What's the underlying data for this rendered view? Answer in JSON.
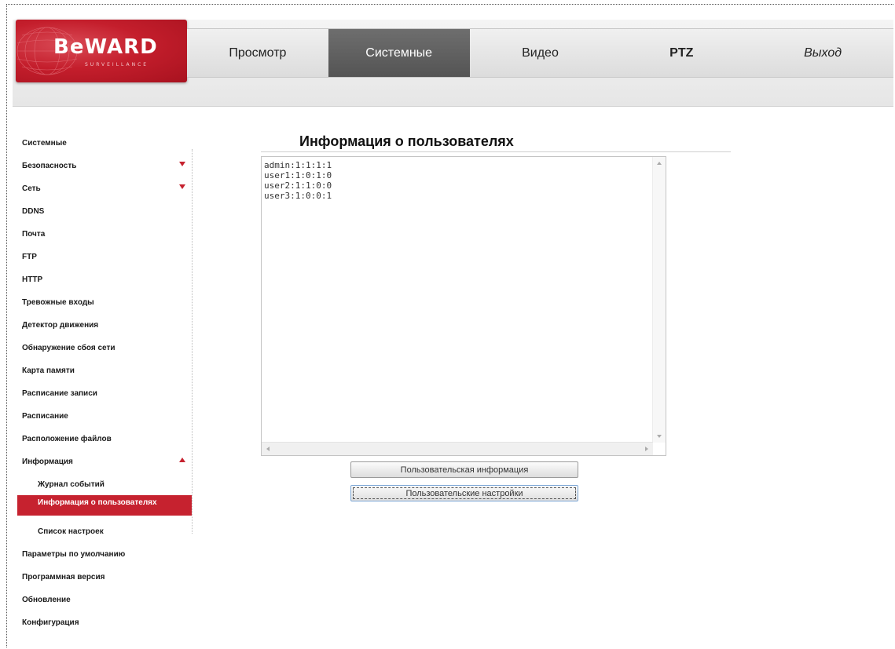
{
  "logo": {
    "text": "BeWARD",
    "subtext": "SURVEILLANCE",
    "icon": "beward-logo-icon",
    "color": "#c41e2c"
  },
  "nav": {
    "items": [
      {
        "label": "Просмотр"
      },
      {
        "label": "Системные",
        "active": true
      },
      {
        "label": "Видео"
      },
      {
        "label": "PTZ"
      },
      {
        "label": "Выход"
      }
    ]
  },
  "sidebar": {
    "items": [
      {
        "label": "Системные"
      },
      {
        "label": "Безопасность",
        "arrow": "chevron-down-icon"
      },
      {
        "label": "Сеть",
        "arrow": "chevron-down-icon"
      },
      {
        "label": "DDNS"
      },
      {
        "label": "Почта"
      },
      {
        "label": "FTP"
      },
      {
        "label": "HTTP"
      },
      {
        "label": "Тревожные входы"
      },
      {
        "label": "Детектор движения"
      },
      {
        "label": "Обнаружение сбоя сети"
      },
      {
        "label": "Карта памяти"
      },
      {
        "label": "Расписание записи"
      },
      {
        "label": "Расписание"
      },
      {
        "label": "Расположение файлов"
      },
      {
        "label": "Информация",
        "arrow": "chevron-up-icon"
      },
      {
        "label": "Журнал событий",
        "sub": true
      },
      {
        "label": "Информация о пользователях",
        "sub": true,
        "active": true
      },
      {
        "label": "Список настроек",
        "sub": true
      },
      {
        "label": "Параметры по умолчанию"
      },
      {
        "label": "Программная версия"
      },
      {
        "label": "Обновление"
      },
      {
        "label": "Конфигурация"
      }
    ],
    "active_color": "#c6222f"
  },
  "main": {
    "title": "Информация о пользователях",
    "users_text": "admin:1:1:1:1\nuser1:1:0:1:0\nuser2:1:1:0:0\nuser3:1:0:0:1",
    "buttons": {
      "user_info_label": "Пользовательская информация",
      "user_settings_label": "Пользовательские настройки"
    }
  }
}
